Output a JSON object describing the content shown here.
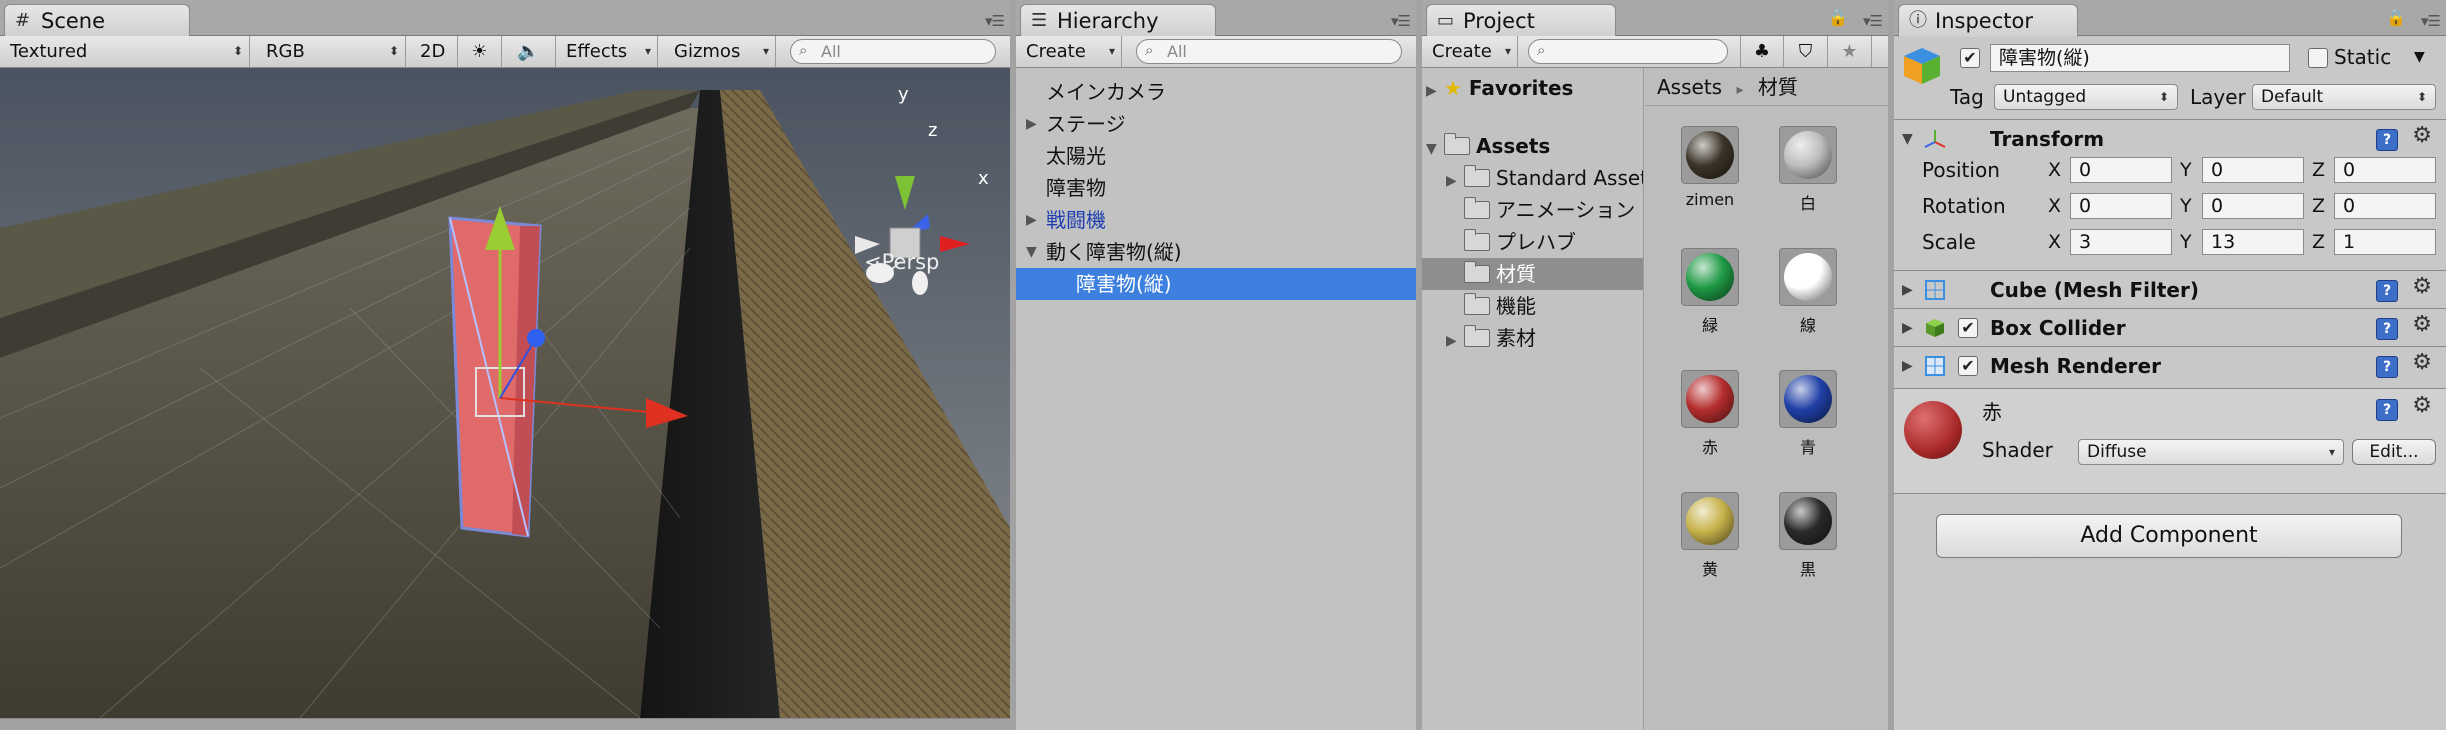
{
  "scene": {
    "tab_label": "Scene",
    "toolbar": {
      "render_mode": "Textured",
      "color_mode": "RGB",
      "mode_2d": "2D",
      "effects": "Effects",
      "gizmos": "Gizmos",
      "search_placeholder": "All"
    },
    "gizmo": {
      "axis_x": "x",
      "axis_y": "y",
      "axis_z": "z",
      "projection": "Persp"
    }
  },
  "hierarchy": {
    "tab_label": "Hierarchy",
    "create_label": "Create",
    "search_placeholder": "All",
    "items": [
      {
        "label": "メインカメラ"
      },
      {
        "label": "ステージ"
      },
      {
        "label": "太陽光"
      },
      {
        "label": "障害物"
      },
      {
        "label": "戦闘機"
      },
      {
        "label": "動く障害物(縦)"
      },
      {
        "label": "障害物(縦)"
      }
    ]
  },
  "project": {
    "tab_label": "Project",
    "create_label": "Create",
    "favorites_label": "Favorites",
    "tree": [
      {
        "label": "Assets"
      },
      {
        "label": "Standard Assets"
      },
      {
        "label": "アニメーション"
      },
      {
        "label": "プレハブ"
      },
      {
        "label": "材質"
      },
      {
        "label": "機能"
      },
      {
        "label": "素材"
      }
    ],
    "breadcrumb": {
      "root": "Assets",
      "separator": "▸",
      "current": "材質"
    },
    "assets": [
      {
        "name": "zimen",
        "color": "#3b3427"
      },
      {
        "name": "白",
        "color": "#bdbdbd"
      },
      {
        "name": "緑",
        "color": "#1f9a45"
      },
      {
        "name": "線",
        "color": "#ffffff"
      },
      {
        "name": "赤",
        "color": "#b52d2d"
      },
      {
        "name": "青",
        "color": "#1f3fa6"
      },
      {
        "name": "黄",
        "color": "#c7b24a"
      },
      {
        "name": "黒",
        "color": "#2a2a2a"
      }
    ]
  },
  "inspector": {
    "tab_label": "Inspector",
    "object_name": "障害物(縦)",
    "static_label": "Static",
    "tag_label": "Tag",
    "tag_value": "Untagged",
    "layer_label": "Layer",
    "layer_value": "Default",
    "transform": {
      "title": "Transform",
      "position_label": "Position",
      "rotation_label": "Rotation",
      "scale_label": "Scale",
      "x": "X",
      "y": "Y",
      "z": "Z",
      "position": [
        "0",
        "0",
        "0"
      ],
      "rotation": [
        "0",
        "0",
        "0"
      ],
      "scale": [
        "3",
        "13",
        "1"
      ]
    },
    "components": [
      {
        "title": "Cube (Mesh Filter)"
      },
      {
        "title": "Box Collider"
      },
      {
        "title": "Mesh Renderer"
      }
    ],
    "material": {
      "name": "赤",
      "shader_label": "Shader",
      "shader_value": "Diffuse",
      "edit_label": "Edit..."
    },
    "add_component_label": "Add Component"
  }
}
